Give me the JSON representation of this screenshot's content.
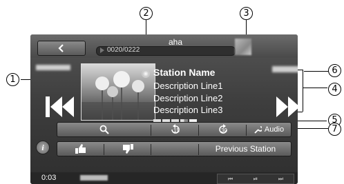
{
  "app_title": "aha",
  "track_counter": "0020/0222",
  "station": {
    "name": "Station Name",
    "lines": [
      "Description Line1",
      "Description Line2",
      "Description Line3"
    ]
  },
  "rating_stars": 3.5,
  "rating_max": 5,
  "controls": {
    "search_icon": "search-icon",
    "rewind_label": "15",
    "forward_label": "30",
    "audio_label": "Audio",
    "previous_station_label": "Previous Station"
  },
  "status": {
    "time": "0:03"
  },
  "callouts": [
    "1",
    "2",
    "3",
    "4",
    "5",
    "6",
    "7"
  ],
  "colors": {
    "screen": "#3e3e3e",
    "button": "#6e6e6e",
    "text": "#ffffff"
  }
}
